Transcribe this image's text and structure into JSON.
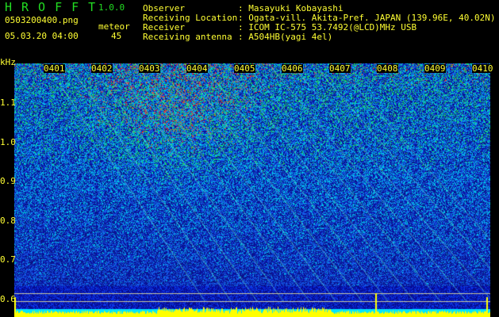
{
  "header": {
    "app_title": "HROFFT",
    "version": "1.0.0",
    "filename": "0503200400.png",
    "datetime": "05.03.20 04:00",
    "meteor_label": "meteor",
    "meteor_count": "45"
  },
  "info": [
    {
      "label": "Observer",
      "value": ": Masayuki Kobayashi"
    },
    {
      "label": "Receiving Location",
      "value": ": Ogata-vill. Akita-Pref. JAPAN (139.96E, 40.02N)"
    },
    {
      "label": "Receiver",
      "value": ": ICOM IC-575 53.7492(@LCD)MHz USB"
    },
    {
      "label": "Receiving antenna",
      "value": ": A504HB(yagi 4el)"
    }
  ],
  "spectrogram": {
    "y_unit": "kHz",
    "y_ticks": [
      "1.1",
      "1.0",
      "0.9",
      "0.8",
      "0.7",
      "0.6"
    ],
    "x_ticks": [
      "0401",
      "0402",
      "0403",
      "0404",
      "0405",
      "0406",
      "0407",
      "0408",
      "0409",
      "0410"
    ],
    "colors": {
      "background": "#0a1a8a",
      "noise": "#1e6cff",
      "signal": "#22dd55",
      "peak": "#ff3322",
      "level": "#ffff00",
      "baseline": "#00e5ff"
    }
  }
}
